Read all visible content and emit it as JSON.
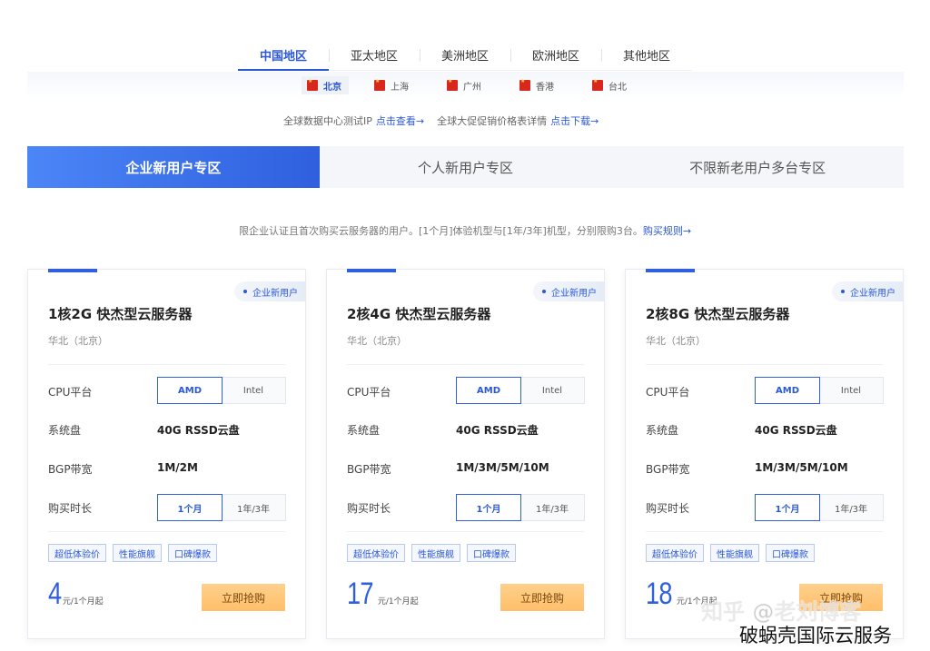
{
  "region_tabs": [
    {
      "label": "中国地区",
      "active": true
    },
    {
      "label": "亚太地区",
      "active": false
    },
    {
      "label": "美洲地区",
      "active": false
    },
    {
      "label": "欧洲地区",
      "active": false
    },
    {
      "label": "其他地区",
      "active": false
    }
  ],
  "cities": [
    {
      "label": "北京",
      "active": true
    },
    {
      "label": "上海",
      "active": false
    },
    {
      "label": "广州",
      "active": false
    },
    {
      "label": "香港",
      "active": false
    },
    {
      "label": "台北",
      "active": false
    }
  ],
  "links": {
    "test_ip_text": "全球数据中心测试IP",
    "test_ip_link": "点击查看→",
    "promo_text": "全球大促促销价格表详情",
    "promo_link": "点击下载→"
  },
  "user_tabs": [
    {
      "label": "企业新用户专区",
      "active": true
    },
    {
      "label": "个人新用户专区",
      "active": false
    },
    {
      "label": "不限新老用户多台专区",
      "active": false
    }
  ],
  "notice": {
    "text": "限企业认证且首次购买云服务器的用户。[1个月]体验机型与[1年/3年]机型，分别限购3台。",
    "link": "购买规则→"
  },
  "labels": {
    "cpu": "CPU平台",
    "disk": "系统盘",
    "bandwidth": "BGP带宽",
    "duration": "购买时长",
    "buy": "立即抢购"
  },
  "cards": [
    {
      "badge": "企业新用户",
      "title": "1核2G 快杰型云服务器",
      "location": "华北（北京）",
      "cpu_options": [
        "AMD",
        "Intel"
      ],
      "disk": "40G RSSD云盘",
      "bandwidth": "1M/2M",
      "duration_options": [
        "1个月",
        "1年/3年"
      ],
      "tags": [
        "超低体验价",
        "性能旗舰",
        "口碑爆款"
      ],
      "price": "4",
      "price_unit": "元/1个月起"
    },
    {
      "badge": "企业新用户",
      "title": "2核4G 快杰型云服务器",
      "location": "华北（北京）",
      "cpu_options": [
        "AMD",
        "Intel"
      ],
      "disk": "40G RSSD云盘",
      "bandwidth": "1M/3M/5M/10M",
      "duration_options": [
        "1个月",
        "1年/3年"
      ],
      "tags": [
        "超低体验价",
        "性能旗舰",
        "口碑爆款"
      ],
      "price": "17",
      "price_unit": "元/1个月起"
    },
    {
      "badge": "企业新用户",
      "title": "2核8G 快杰型云服务器",
      "location": "华北（北京）",
      "cpu_options": [
        "AMD",
        "Intel"
      ],
      "disk": "40G RSSD云盘",
      "bandwidth": "1M/3M/5M/10M",
      "duration_options": [
        "1个月",
        "1年/3年"
      ],
      "tags": [
        "超低体验价",
        "性能旗舰",
        "口碑爆款"
      ],
      "price": "18",
      "price_unit": "元/1个月起"
    }
  ],
  "watermarks": {
    "zhihu": "知乎 @老刘博客",
    "bottom": "破蜗壳国际云服务"
  },
  "colors": {
    "accent": "#2f5fde",
    "buy_button": "#ffbf6a"
  }
}
